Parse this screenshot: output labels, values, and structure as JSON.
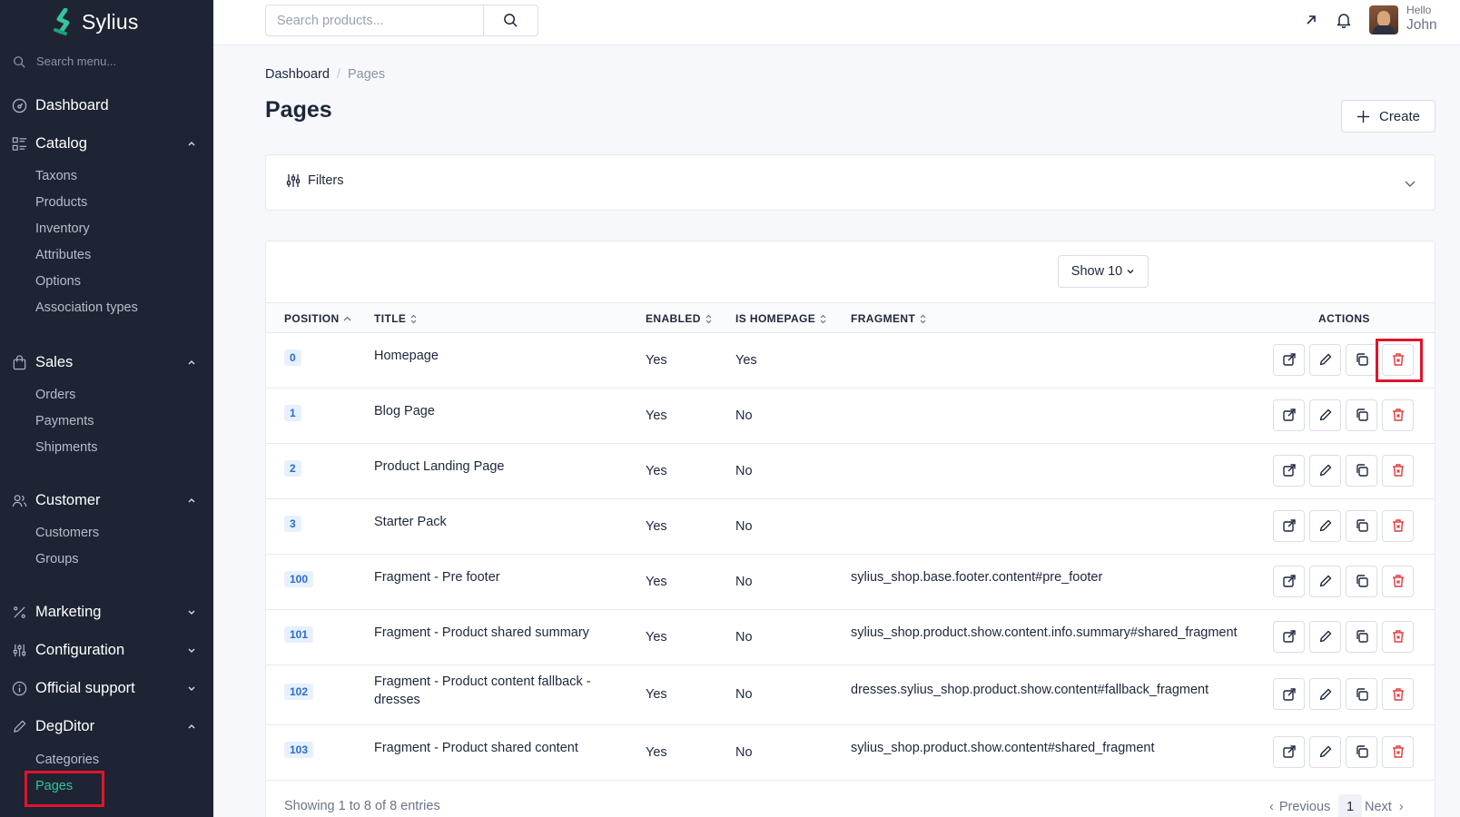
{
  "sidebar": {
    "logo_text": "Sylius",
    "search_placeholder": "Search menu...",
    "dashboard": "Dashboard",
    "catalog": {
      "label": "Catalog",
      "items": [
        "Taxons",
        "Products",
        "Inventory",
        "Attributes",
        "Options",
        "Association types"
      ]
    },
    "sales": {
      "label": "Sales",
      "items": [
        "Orders",
        "Payments",
        "Shipments"
      ]
    },
    "customer": {
      "label": "Customer",
      "items": [
        "Customers",
        "Groups"
      ]
    },
    "marketing": "Marketing",
    "configuration": "Configuration",
    "official_support": "Official support",
    "degditor": {
      "label": "DegDitor",
      "items": [
        "Categories",
        "Pages"
      ]
    }
  },
  "topbar": {
    "search_placeholder": "Search products...",
    "greeting": "Hello",
    "user_name": "John"
  },
  "breadcrumb": {
    "home": "Dashboard",
    "separator": "/",
    "current": "Pages"
  },
  "page": {
    "title": "Pages",
    "create_label": "Create"
  },
  "filters": {
    "label": "Filters"
  },
  "table": {
    "show_label": "Show 10",
    "headers": {
      "position": "POSITION",
      "title": "TITLE",
      "enabled": "ENABLED",
      "is_homepage": "IS HOMEPAGE",
      "fragment": "FRAGMENT",
      "actions": "ACTIONS"
    },
    "rows": [
      {
        "position": "0",
        "title": "Homepage",
        "enabled": "Yes",
        "homepage": "Yes",
        "fragment": ""
      },
      {
        "position": "1",
        "title": "Blog Page",
        "enabled": "Yes",
        "homepage": "No",
        "fragment": ""
      },
      {
        "position": "2",
        "title": "Product Landing Page",
        "enabled": "Yes",
        "homepage": "No",
        "fragment": ""
      },
      {
        "position": "3",
        "title": "Starter Pack",
        "enabled": "Yes",
        "homepage": "No",
        "fragment": ""
      },
      {
        "position": "100",
        "title": "Fragment - Pre footer",
        "enabled": "Yes",
        "homepage": "No",
        "fragment": "sylius_shop.base.footer.content#pre_footer"
      },
      {
        "position": "101",
        "title": "Fragment - Product shared summary",
        "enabled": "Yes",
        "homepage": "No",
        "fragment": "sylius_shop.product.show.content.info.summary#shared_fragment"
      },
      {
        "position": "102",
        "title_line1": "Fragment - Product content fallback -",
        "title_line2": "dresses",
        "enabled": "Yes",
        "homepage": "No",
        "fragment": "dresses.sylius_shop.product.show.content#fallback_fragment"
      },
      {
        "position": "103",
        "title": "Fragment - Product shared content",
        "enabled": "Yes",
        "homepage": "No",
        "fragment": "sylius_shop.product.show.content#shared_fragment"
      }
    ],
    "footer_info": "Showing 1 to 8 of 8 entries",
    "pagination": {
      "previous": "Previous",
      "page": "1",
      "next": "Next"
    }
  },
  "colors": {
    "sidebar_bg": "#1e2433",
    "accent_green": "#35c49b",
    "delete_red": "#e23a3a",
    "highlight_red": "#e0142b",
    "badge_blue": "#2a6bd1"
  }
}
